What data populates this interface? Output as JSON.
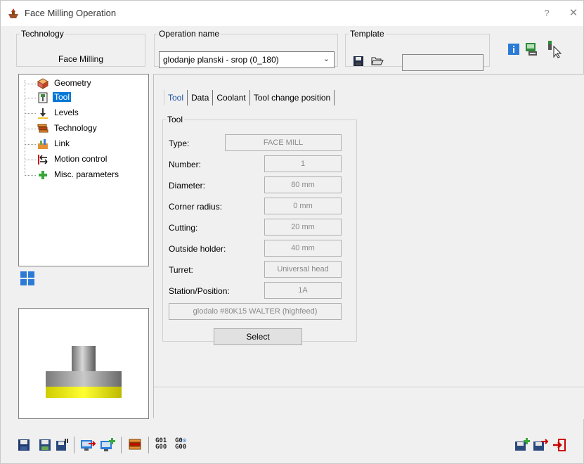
{
  "window": {
    "title": "Face Milling Operation",
    "help_label": "?",
    "close_label": "✕"
  },
  "technology": {
    "legend": "Technology",
    "value": "Face Milling"
  },
  "operation": {
    "legend": "Operation name",
    "value": "glodanje planski - srop (0_180)"
  },
  "template": {
    "legend": "Template"
  },
  "tree": {
    "items": [
      {
        "label": "Geometry",
        "icon": "geometry-icon"
      },
      {
        "label": "Tool",
        "icon": "tool-icon",
        "selected": true
      },
      {
        "label": "Levels",
        "icon": "levels-icon"
      },
      {
        "label": "Technology",
        "icon": "technology-icon"
      },
      {
        "label": "Link",
        "icon": "link-icon"
      },
      {
        "label": "Motion control",
        "icon": "motion-control-icon"
      },
      {
        "label": "Misc. parameters",
        "icon": "misc-parameters-icon"
      }
    ]
  },
  "tabs": [
    {
      "label": "Tool",
      "active": true
    },
    {
      "label": "Data"
    },
    {
      "label": "Coolant"
    },
    {
      "label": "Tool change position"
    }
  ],
  "tool": {
    "legend": "Tool",
    "fields": [
      {
        "label": "Type:",
        "value": "FACE MILL"
      },
      {
        "label": "Number:",
        "value": "1"
      },
      {
        "label": "Diameter:",
        "value": "80 mm"
      },
      {
        "label": "Corner radius:",
        "value": "0 mm"
      },
      {
        "label": "Cutting:",
        "value": "20 mm"
      },
      {
        "label": "Outside holder:",
        "value": "40 mm"
      },
      {
        "label": "Turret:",
        "value": "Universal head"
      },
      {
        "label": "Station/Position:",
        "value": "1A"
      }
    ],
    "description": "glodalo #80K15 WALTER (highfeed)",
    "select_label": "Select"
  },
  "bottom_toolbar": {
    "gcode1_top": "G01",
    "gcode1_bottom": "G00",
    "gcode2_top": "G0",
    "gcode2_bottom": "G00"
  },
  "colors": {
    "selection": "#0078d7",
    "tab_active": "#1a4fa0",
    "tool_yellow": "#f2ef00",
    "tool_gray": "#9a9a9a"
  }
}
